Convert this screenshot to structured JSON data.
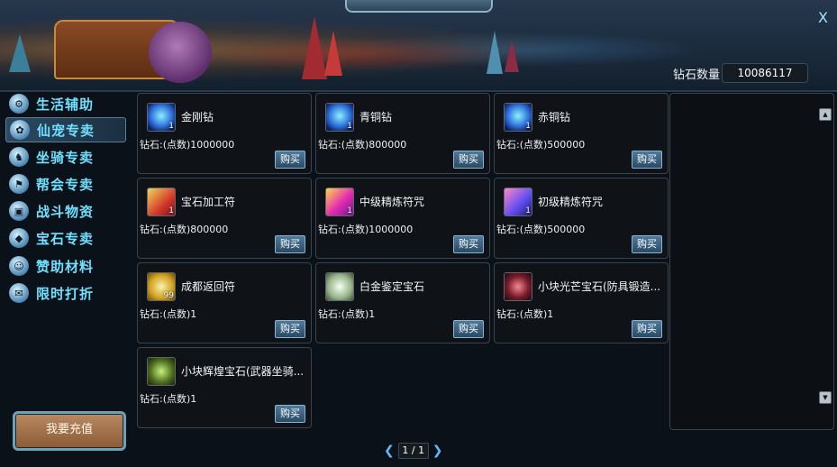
{
  "header": {
    "close_label": "X",
    "diamond_count_label": "钻石数量",
    "diamond_count_value": "10086117"
  },
  "sidebar": {
    "items": [
      {
        "label": "生活辅助",
        "icon": "gear-icon"
      },
      {
        "label": "仙宠专卖",
        "icon": "paw-icon",
        "active": true
      },
      {
        "label": "坐骑专卖",
        "icon": "horse-icon"
      },
      {
        "label": "帮会专卖",
        "icon": "flag-icon"
      },
      {
        "label": "战斗物资",
        "icon": "box-icon"
      },
      {
        "label": "宝石专卖",
        "icon": "gem-icon"
      },
      {
        "label": "赞助材料",
        "icon": "person-icon"
      },
      {
        "label": "限时打折",
        "icon": "megaphone-icon"
      }
    ],
    "recharge_label": "我要充值"
  },
  "shop": {
    "items": [
      {
        "name": "金刚钻",
        "price": "钻石:(点数)1000000",
        "count": "1",
        "icon": "diamond-icon",
        "buy_label": "购买"
      },
      {
        "name": "青铜钻",
        "price": "钻石:(点数)800000",
        "count": "1",
        "icon": "diamond-icon",
        "buy_label": "购买"
      },
      {
        "name": "赤铜钻",
        "price": "钻石:(点数)500000",
        "count": "1",
        "icon": "diamond-icon",
        "buy_label": "购买"
      },
      {
        "name": "宝石加工符",
        "price": "钻石:(点数)800000",
        "count": "1",
        "icon": "talisman-icon",
        "buy_label": "购买"
      },
      {
        "name": "中级精炼符咒",
        "price": "钻石:(点数)1000000",
        "count": "1",
        "icon": "talisman-icon",
        "buy_label": "购买"
      },
      {
        "name": "初级精炼符咒",
        "price": "钻石:(点数)500000",
        "count": "1",
        "icon": "talisman-icon",
        "buy_label": "购买"
      },
      {
        "name": "成都返回符",
        "price": "钻石:(点数)1",
        "count": "99",
        "icon": "return-talisman-icon",
        "buy_label": "购买"
      },
      {
        "name": "白金鉴定宝石",
        "price": "钻石:(点数)1",
        "count": "",
        "icon": "gem-icon",
        "buy_label": "购买"
      },
      {
        "name": "小块光芒宝石(防具锻造...",
        "price": "钻石:(点数)1",
        "count": "",
        "icon": "gem-icon",
        "buy_label": "购买"
      },
      {
        "name": "小块辉煌宝石(武器坐骑...",
        "price": "钻石:(点数)1",
        "count": "",
        "icon": "gem-icon",
        "buy_label": "购买"
      }
    ]
  },
  "pager": {
    "text": "1 / 1",
    "prev_label": "❮",
    "next_label": "❯"
  },
  "scroll": {
    "up_label": "▲",
    "down_label": "▼"
  }
}
